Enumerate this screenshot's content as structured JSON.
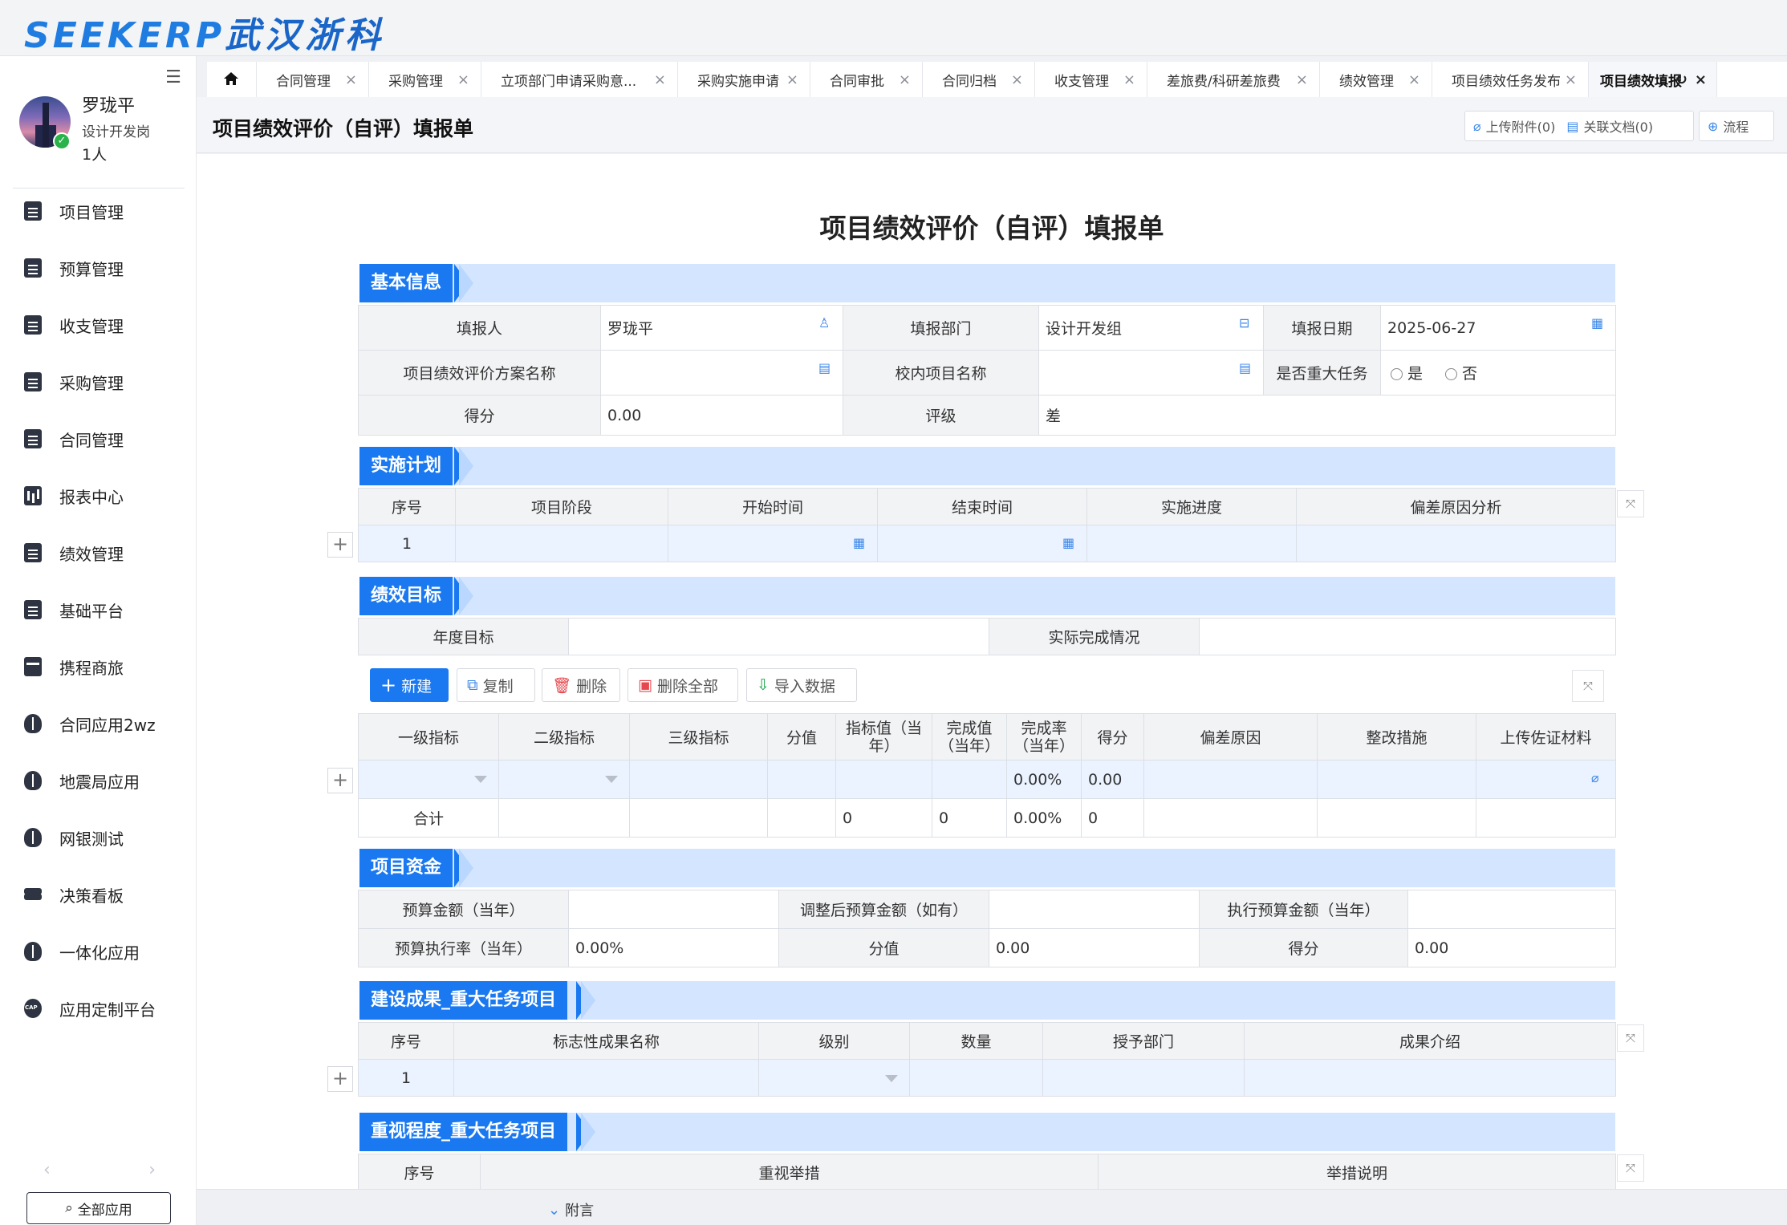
{
  "brand": {
    "logo_latin": "SEEKERP",
    "logo_cn": "武汉浙科"
  },
  "user": {
    "name": "罗珑平",
    "role": "设计开发岗",
    "count": "1人"
  },
  "sidebar": {
    "items": [
      {
        "label": "项目管理",
        "icon": "document-icon"
      },
      {
        "label": "预算管理",
        "icon": "document-icon"
      },
      {
        "label": "收支管理",
        "icon": "document-icon"
      },
      {
        "label": "采购管理",
        "icon": "document-icon"
      },
      {
        "label": "合同管理",
        "icon": "document-icon"
      },
      {
        "label": "报表中心",
        "icon": "bar-chart-icon"
      },
      {
        "label": "绩效管理",
        "icon": "document-icon"
      },
      {
        "label": "基础平台",
        "icon": "document-icon"
      },
      {
        "label": "携程商旅",
        "icon": "card-icon"
      },
      {
        "label": "合同应用2wz",
        "icon": "cube-icon"
      },
      {
        "label": "地震局应用",
        "icon": "cube-icon"
      },
      {
        "label": "网银测试",
        "icon": "cube-icon"
      },
      {
        "label": "决策看板",
        "icon": "layers-icon"
      },
      {
        "label": "一体化应用",
        "icon": "cube-icon"
      },
      {
        "label": "应用定制平台",
        "icon": "cap-icon"
      }
    ],
    "all_apps_label": "全部应用"
  },
  "tabs": [
    {
      "label": "合同管理"
    },
    {
      "label": "采购管理"
    },
    {
      "label": "立项部门申请采购意..."
    },
    {
      "label": "采购实施申请"
    },
    {
      "label": "合同审批"
    },
    {
      "label": "合同归档"
    },
    {
      "label": "收支管理"
    },
    {
      "label": "差旅费/科研差旅费"
    },
    {
      "label": "绩效管理"
    },
    {
      "label": "项目绩效任务发布"
    },
    {
      "label": "项目绩效填报"
    }
  ],
  "page": {
    "title": "项目绩效评价（自评）填报单",
    "upload_label": "上传附件(0)",
    "related_label": "关联文档(0)",
    "flow_label": "流程"
  },
  "form": {
    "title": "项目绩效评价（自评）填报单",
    "basic": {
      "section": "基本信息",
      "reporter_label": "填报人",
      "reporter": "罗珑平",
      "dept_label": "填报部门",
      "dept": "设计开发组",
      "date_label": "填报日期",
      "date": "2025-06-27",
      "plan_label": "项目绩效评价方案名称",
      "plan": "",
      "campus_label": "校内项目名称",
      "campus": "",
      "major_label": "是否重大任务",
      "yes": "是",
      "no": "否",
      "score_label": "得分",
      "score": "0.00",
      "grade_label": "评级",
      "grade": "差"
    },
    "impl": {
      "section": "实施计划",
      "headers": [
        "序号",
        "项目阶段",
        "开始时间",
        "结束时间",
        "实施进度",
        "偏差原因分析"
      ],
      "row_no": "1"
    },
    "perf": {
      "section": "绩效目标",
      "annual_label": "年度目标",
      "actual_label": "实际完成情况",
      "btn_new": "新建",
      "btn_copy": "复制",
      "btn_delete": "删除",
      "btn_delete_all": "删除全部",
      "btn_import": "导入数据",
      "headers": [
        "一级指标",
        "二级指标",
        "三级指标",
        "分值",
        "指标值（当年）",
        "完成值（当年）",
        "完成率（当年）",
        "得分",
        "偏差原因",
        "整改措施",
        "上传佐证材料"
      ],
      "row_rate": "0.00%",
      "row_score": "0.00",
      "total_label": "合计",
      "total_value1": "0",
      "total_value2": "0",
      "total_rate": "0.00%",
      "total_score": "0"
    },
    "fund": {
      "section": "项目资金",
      "budget_label": "预算金额（当年）",
      "budget": "",
      "adjusted_label": "调整后预算金额（如有）",
      "adjusted": "",
      "exec_label": "执行预算金额（当年）",
      "exec": "",
      "rate_label": "预算执行率（当年）",
      "rate": "0.00%",
      "points_label": "分值",
      "points": "0.00",
      "score_label": "得分",
      "score": "0.00"
    },
    "build": {
      "section": "建设成果_重大任务项目",
      "headers": [
        "序号",
        "标志性成果名称",
        "级别",
        "数量",
        "授予部门",
        "成果介绍"
      ],
      "row_no": "1"
    },
    "attention": {
      "section": "重视程度_重大任务项目",
      "headers": [
        "序号",
        "重视举措",
        "举措说明"
      ]
    }
  },
  "footer": {
    "label": "附言"
  },
  "colors": {
    "accent": "#1a79f0",
    "section_band": "#d4e6ff",
    "row_highlight": "#eaf3ff"
  }
}
